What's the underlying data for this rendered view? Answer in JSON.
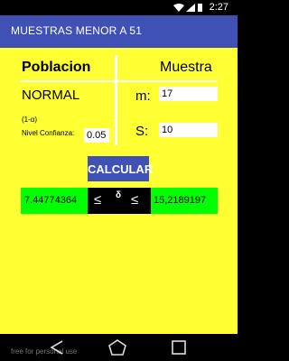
{
  "status_bar": {
    "time": "2:27",
    "icons": [
      "wifi-icon",
      "signal-icon",
      "battery-icon"
    ]
  },
  "app_bar": {
    "title": "MUESTRAS MENOR A 51",
    "color": "#3f51b5"
  },
  "form": {
    "header_left": "Poblacion",
    "header_right": "Muestra",
    "distribution": "NORMAL",
    "m_label": "m:",
    "m_value": "17",
    "s_label": "S:",
    "s_value": "10",
    "alpha_label": "(1-α)",
    "confidence_label": "Nivel Confianza:",
    "confidence_value": "0.05",
    "background": "#ffff33"
  },
  "calc_button": {
    "label": "CALCULAR"
  },
  "result": {
    "lower": "7.44774364",
    "le_symbol_1": "≤",
    "delta_symbol": "δ",
    "le_symbol_2": "≤",
    "upper": "15,2189197",
    "highlight_color": "#00ff00"
  },
  "nav_bar": {
    "watermark": "free for personal use",
    "buttons": [
      "back-icon",
      "home-icon",
      "recent-apps-icon"
    ]
  }
}
